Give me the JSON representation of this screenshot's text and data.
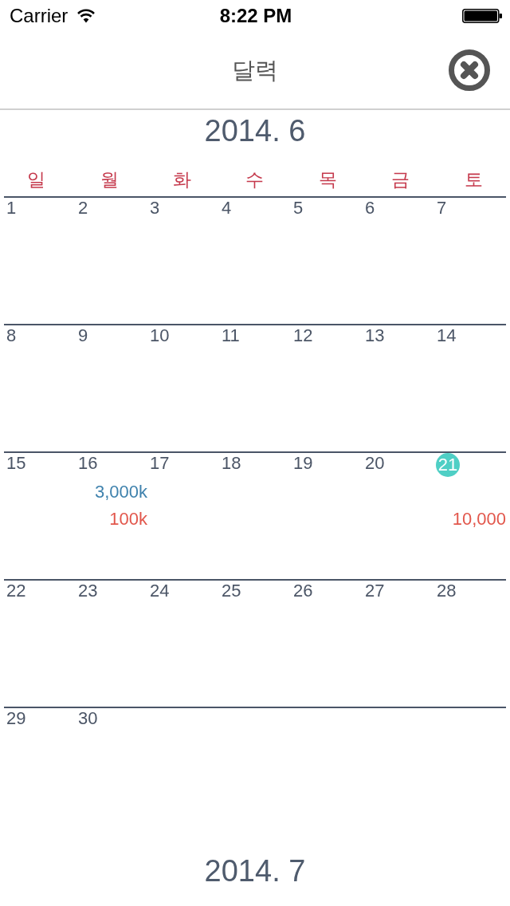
{
  "status_bar": {
    "carrier": "Carrier",
    "time": "8:22 PM"
  },
  "nav_bar": {
    "title": "달력"
  },
  "months": [
    {
      "title": "2014. 6",
      "weekdays": [
        "일",
        "월",
        "화",
        "수",
        "목",
        "금",
        "토"
      ],
      "weeks": [
        [
          {
            "day": "1",
            "selected": false
          },
          {
            "day": "2",
            "selected": false
          },
          {
            "day": "3",
            "selected": false
          },
          {
            "day": "4",
            "selected": false
          },
          {
            "day": "5",
            "selected": false
          },
          {
            "day": "6",
            "selected": false
          },
          {
            "day": "7",
            "selected": false
          }
        ],
        [
          {
            "day": "8",
            "selected": false
          },
          {
            "day": "9",
            "selected": false
          },
          {
            "day": "10",
            "selected": false
          },
          {
            "day": "11",
            "selected": false
          },
          {
            "day": "12",
            "selected": false
          },
          {
            "day": "13",
            "selected": false
          },
          {
            "day": "14",
            "selected": false
          }
        ],
        [
          {
            "day": "15",
            "selected": false
          },
          {
            "day": "16",
            "selected": false,
            "income": "3,000k",
            "expense": "100k"
          },
          {
            "day": "17",
            "selected": false
          },
          {
            "day": "18",
            "selected": false
          },
          {
            "day": "19",
            "selected": false
          },
          {
            "day": "20",
            "selected": false
          },
          {
            "day": "21",
            "selected": true,
            "expense": "10,000"
          }
        ],
        [
          {
            "day": "22",
            "selected": false
          },
          {
            "day": "23",
            "selected": false
          },
          {
            "day": "24",
            "selected": false
          },
          {
            "day": "25",
            "selected": false
          },
          {
            "day": "26",
            "selected": false
          },
          {
            "day": "27",
            "selected": false
          },
          {
            "day": "28",
            "selected": false
          }
        ],
        [
          {
            "day": "29",
            "selected": false
          },
          {
            "day": "30",
            "selected": false
          }
        ]
      ]
    },
    {
      "title": "2014. 7"
    }
  ]
}
